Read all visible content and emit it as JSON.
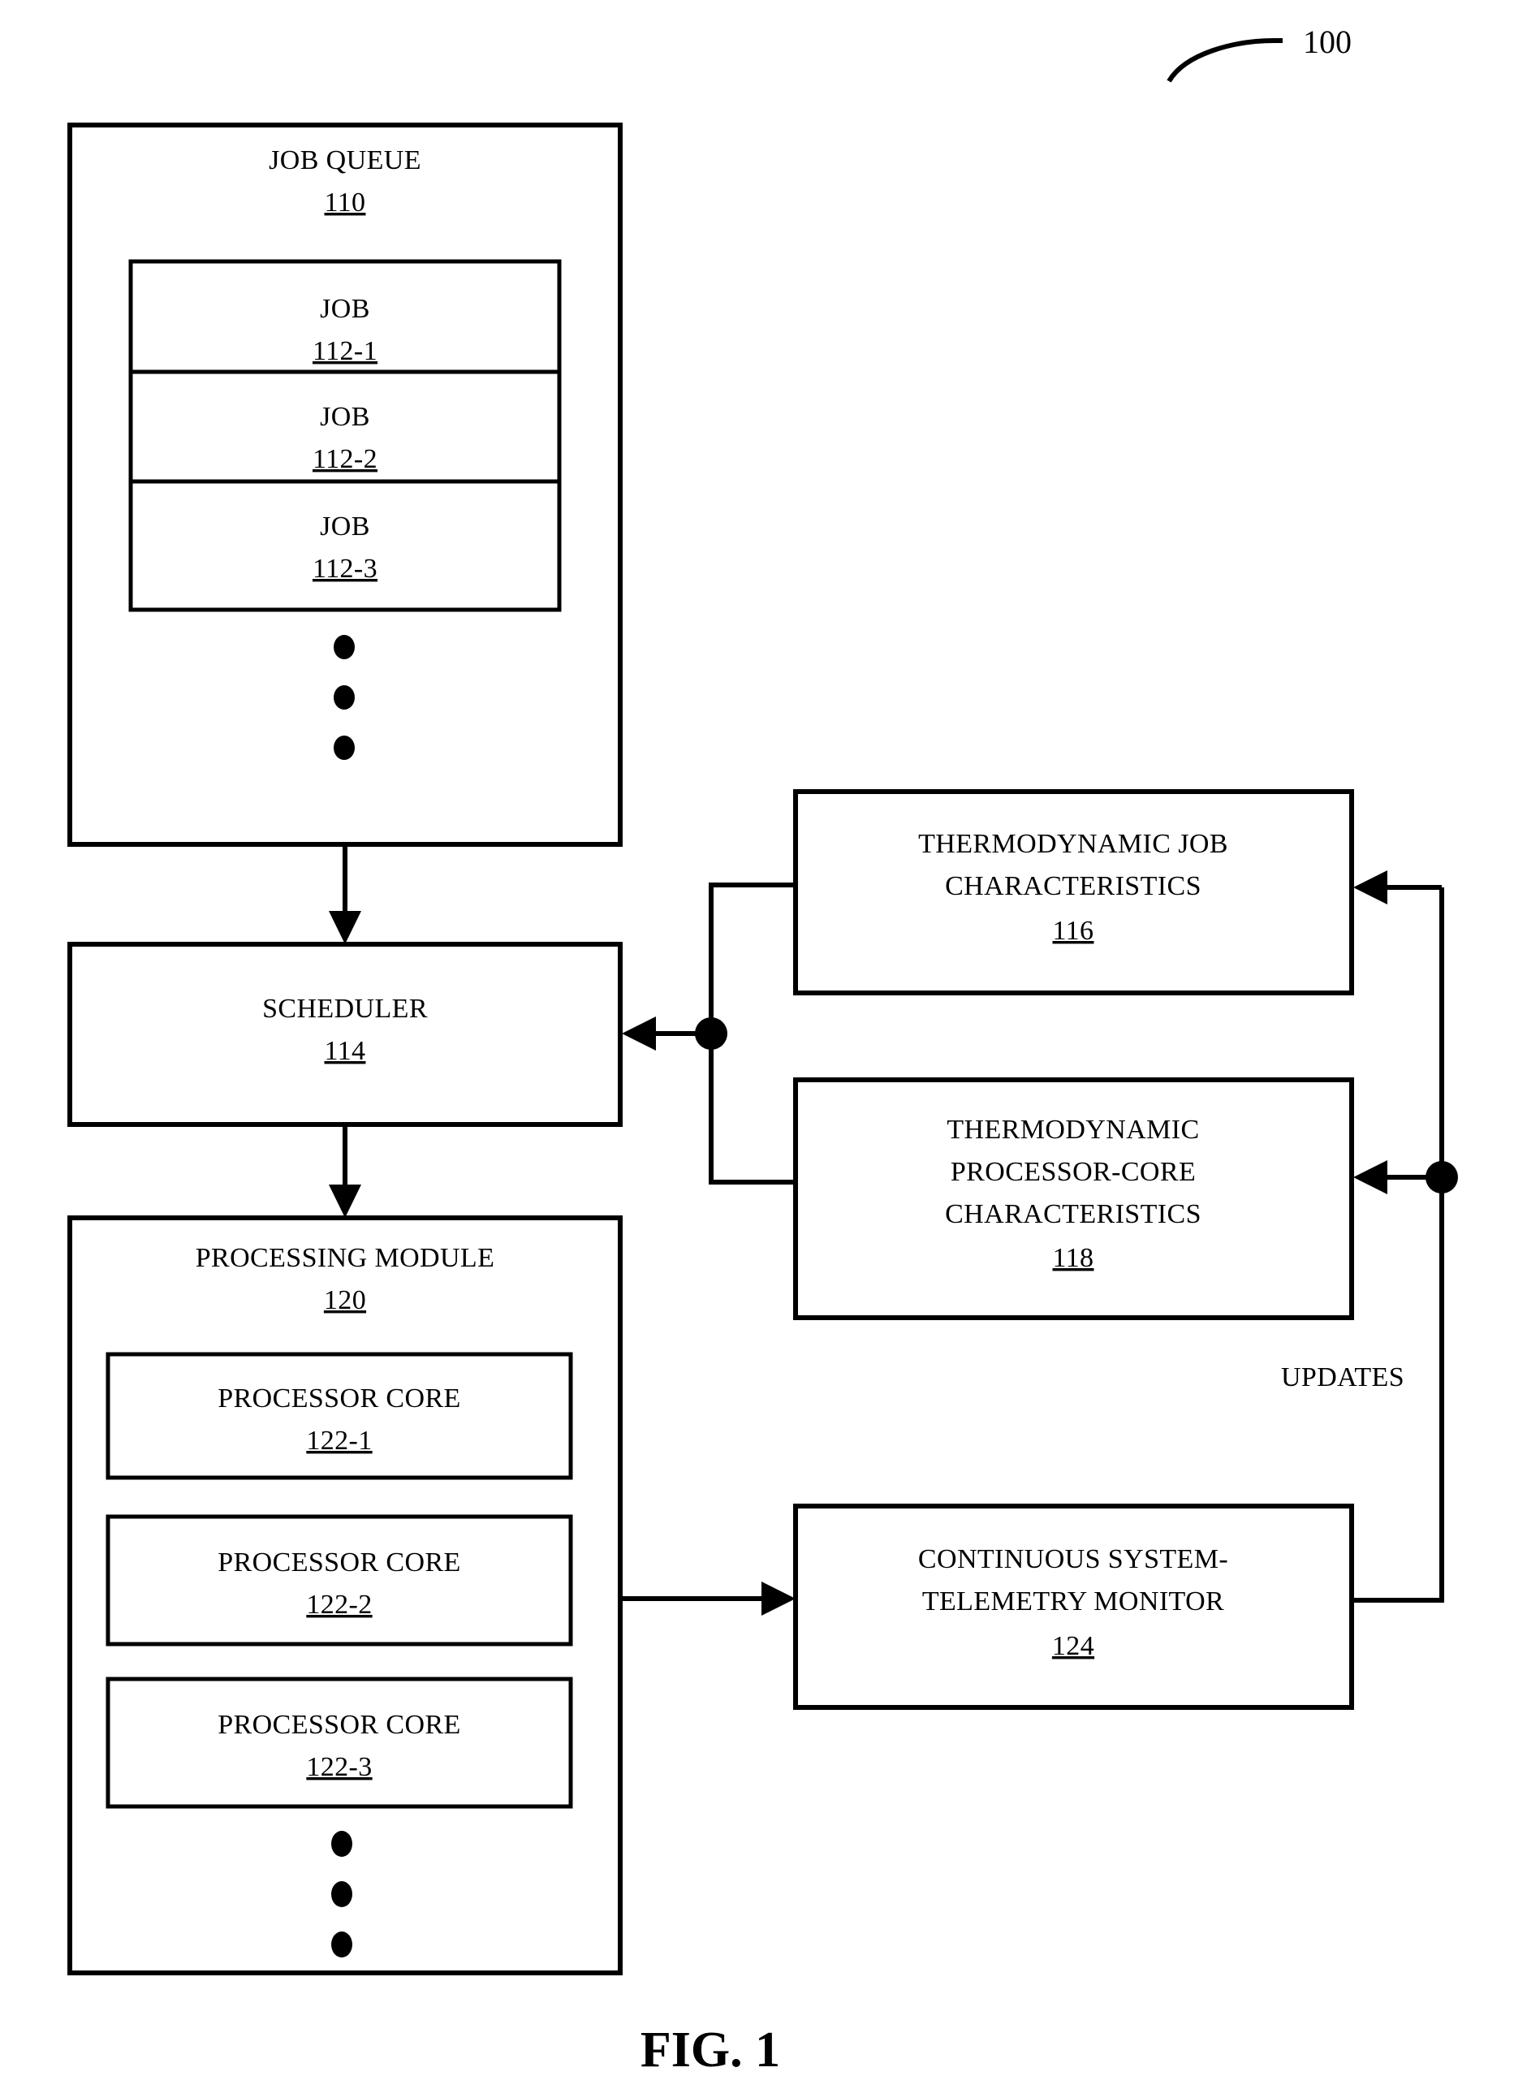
{
  "figure": {
    "caption": "FIG. 1",
    "lead_number": "100"
  },
  "blocks": {
    "job_queue": {
      "title": "JOB QUEUE",
      "ref": "110",
      "jobs": [
        {
          "title": "JOB",
          "ref": "112-1"
        },
        {
          "title": "JOB",
          "ref": "112-2"
        },
        {
          "title": "JOB",
          "ref": "112-3"
        }
      ],
      "ellipsis": "vertical-ellipsis"
    },
    "scheduler": {
      "title": "SCHEDULER",
      "ref": "114"
    },
    "thermo_job": {
      "title_line1": "THERMODYNAMIC JOB",
      "title_line2": "CHARACTERISTICS",
      "ref": "116"
    },
    "thermo_core": {
      "title_line1": "THERMODYNAMIC",
      "title_line2": "PROCESSOR-CORE",
      "title_line3": "CHARACTERISTICS",
      "ref": "118"
    },
    "processing_module": {
      "title": "PROCESSING MODULE",
      "ref": "120",
      "cores": [
        {
          "title": "PROCESSOR CORE",
          "ref": "122-1"
        },
        {
          "title": "PROCESSOR CORE",
          "ref": "122-2"
        },
        {
          "title": "PROCESSOR CORE",
          "ref": "122-3"
        }
      ],
      "ellipsis": "vertical-ellipsis"
    },
    "telemetry_monitor": {
      "title_line1": "CONTINUOUS SYSTEM-",
      "title_line2": "TELEMETRY MONITOR",
      "ref": "124"
    }
  },
  "labels": {
    "updates": "UPDATES"
  },
  "colors": {
    "stroke": "#000000",
    "fill": "#ffffff",
    "text": "#000000"
  }
}
